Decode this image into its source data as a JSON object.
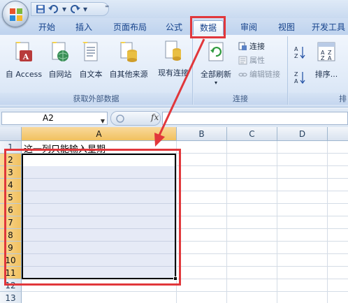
{
  "quick_access": {
    "save_icon": "save-icon",
    "undo_icon": "undo-icon",
    "redo_icon": "redo-icon",
    "customize": "⁼"
  },
  "tabs": [
    {
      "label": "开始"
    },
    {
      "label": "插入"
    },
    {
      "label": "页面布局"
    },
    {
      "label": "公式"
    },
    {
      "label": "数据",
      "active": true
    },
    {
      "label": "审阅"
    },
    {
      "label": "视图"
    },
    {
      "label": "开发工具"
    }
  ],
  "ribbon": {
    "get_external": {
      "label": "获取外部数据",
      "buttons": [
        {
          "label": "自 Access",
          "icon": "access-db-icon"
        },
        {
          "label": "自网站",
          "icon": "web-globe-icon"
        },
        {
          "label": "自文本",
          "icon": "text-file-icon"
        },
        {
          "label": "自其他来源",
          "icon": "other-source-icon"
        }
      ]
    },
    "existing_connections": {
      "label": "现有连接",
      "icon": "existing-connection-icon"
    },
    "connections": {
      "label": "连接",
      "refresh_all": "全部刷新",
      "connect": "连接",
      "properties": "属性",
      "edit_links": "编辑链接"
    },
    "sort": {
      "sort_label": "排序...",
      "partial_label": "排"
    }
  },
  "formula_bar": {
    "name_box": "A2",
    "fx": "fx",
    "content": ""
  },
  "sheet": {
    "columns": [
      "A",
      "B",
      "C",
      "D"
    ],
    "rows": [
      "1",
      "2",
      "3",
      "4",
      "5",
      "6",
      "7",
      "8",
      "9",
      "10",
      "11",
      "12",
      "13"
    ],
    "a1_text": "这一列只能输入星期",
    "selection": "A2:A11"
  },
  "colors": {
    "highlight": "#e1373b",
    "selection_fill": "#e6eaf6",
    "header_selected": "#f1c15f"
  }
}
